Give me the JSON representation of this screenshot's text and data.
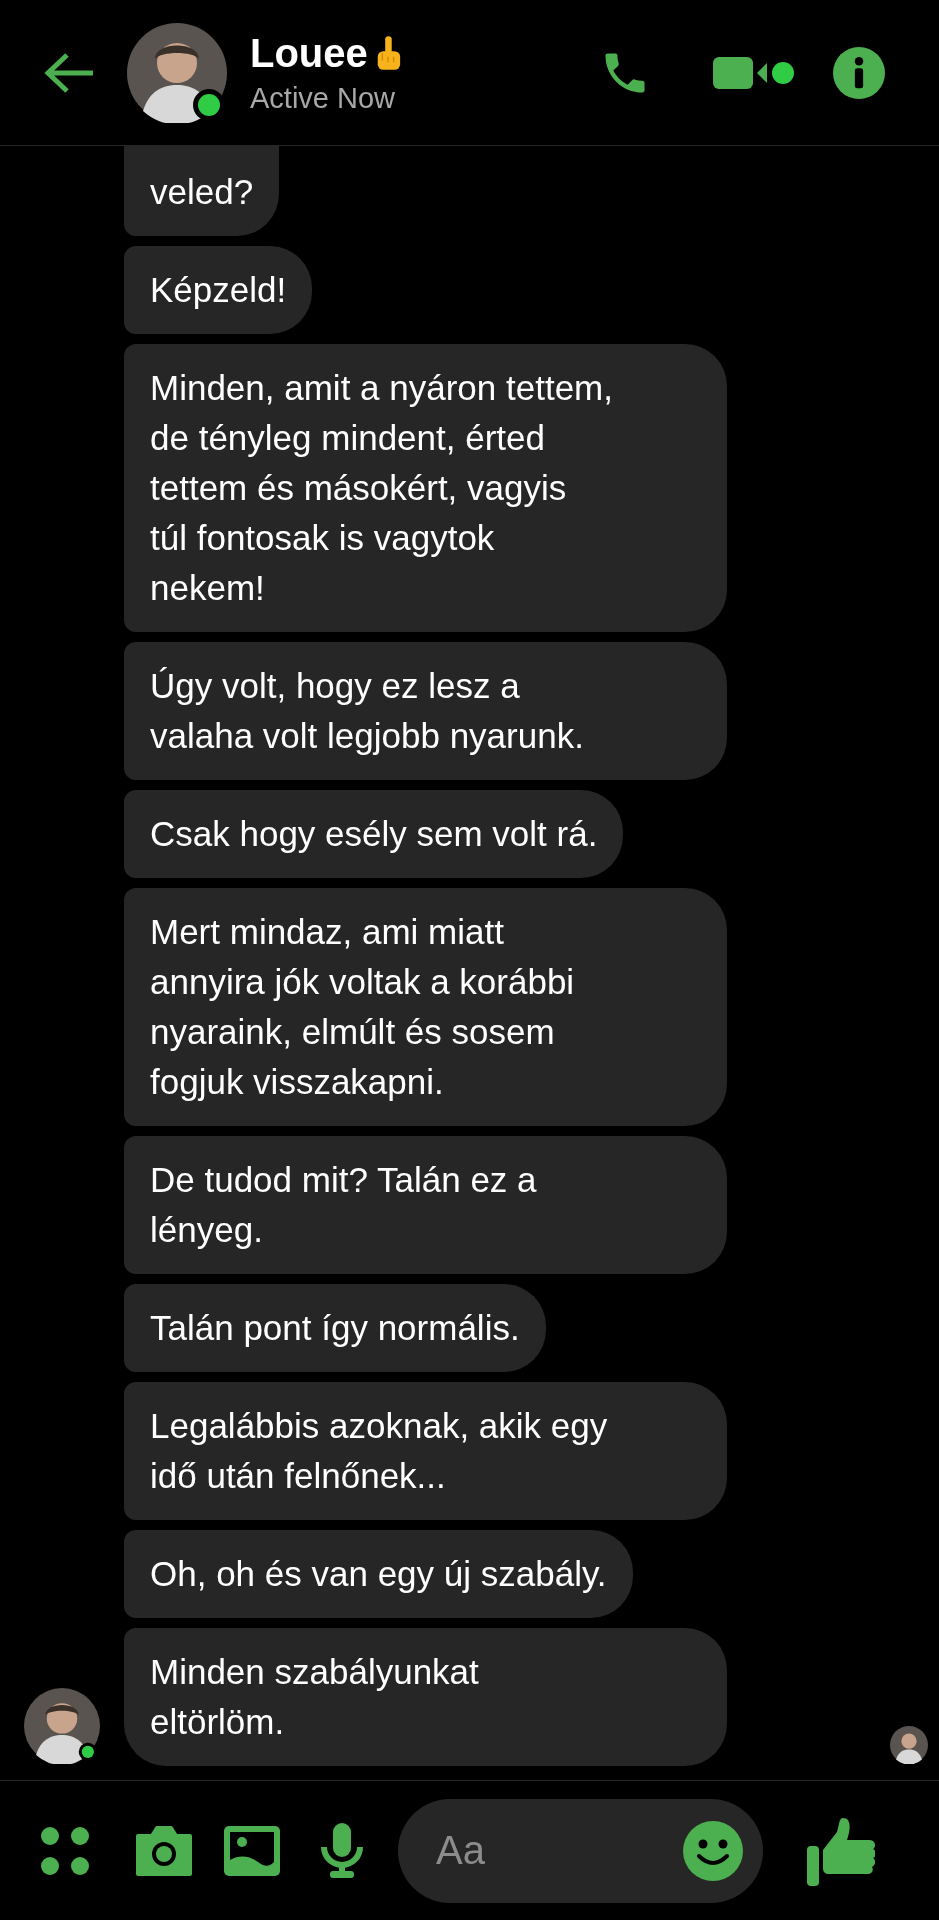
{
  "header": {
    "name": "Louee",
    "status": "Active Now",
    "online": true
  },
  "messages": [
    {
      "text": "veled?"
    },
    {
      "text": "Képzeld!"
    },
    {
      "text": "Minden, amit a nyáron tettem,\nde tényleg mindent, érted\ntettem és másokért, vagyis\ntúl fontosak is vagytok\nnekem!"
    },
    {
      "text": "Úgy volt, hogy ez lesz a\nvalaha volt legjobb nyarunk."
    },
    {
      "text": "Csak hogy esély sem volt rá."
    },
    {
      "text": "Mert mindaz, ami miatt\nannyira jók voltak a korábbi\nnyaraink, elmúlt és sosem\nfogjuk visszakapni."
    },
    {
      "text": "De tudod mit? Talán ez a\nlényeg."
    },
    {
      "text": "Talán pont így normális."
    },
    {
      "text": "Legalábbis azoknak, akik egy\nidő után felnőnek..."
    },
    {
      "text": "Oh, oh és van egy új szabály."
    },
    {
      "text": "Minden szabályunkat\neltörlöm."
    }
  ],
  "composer": {
    "placeholder": "Aa"
  }
}
